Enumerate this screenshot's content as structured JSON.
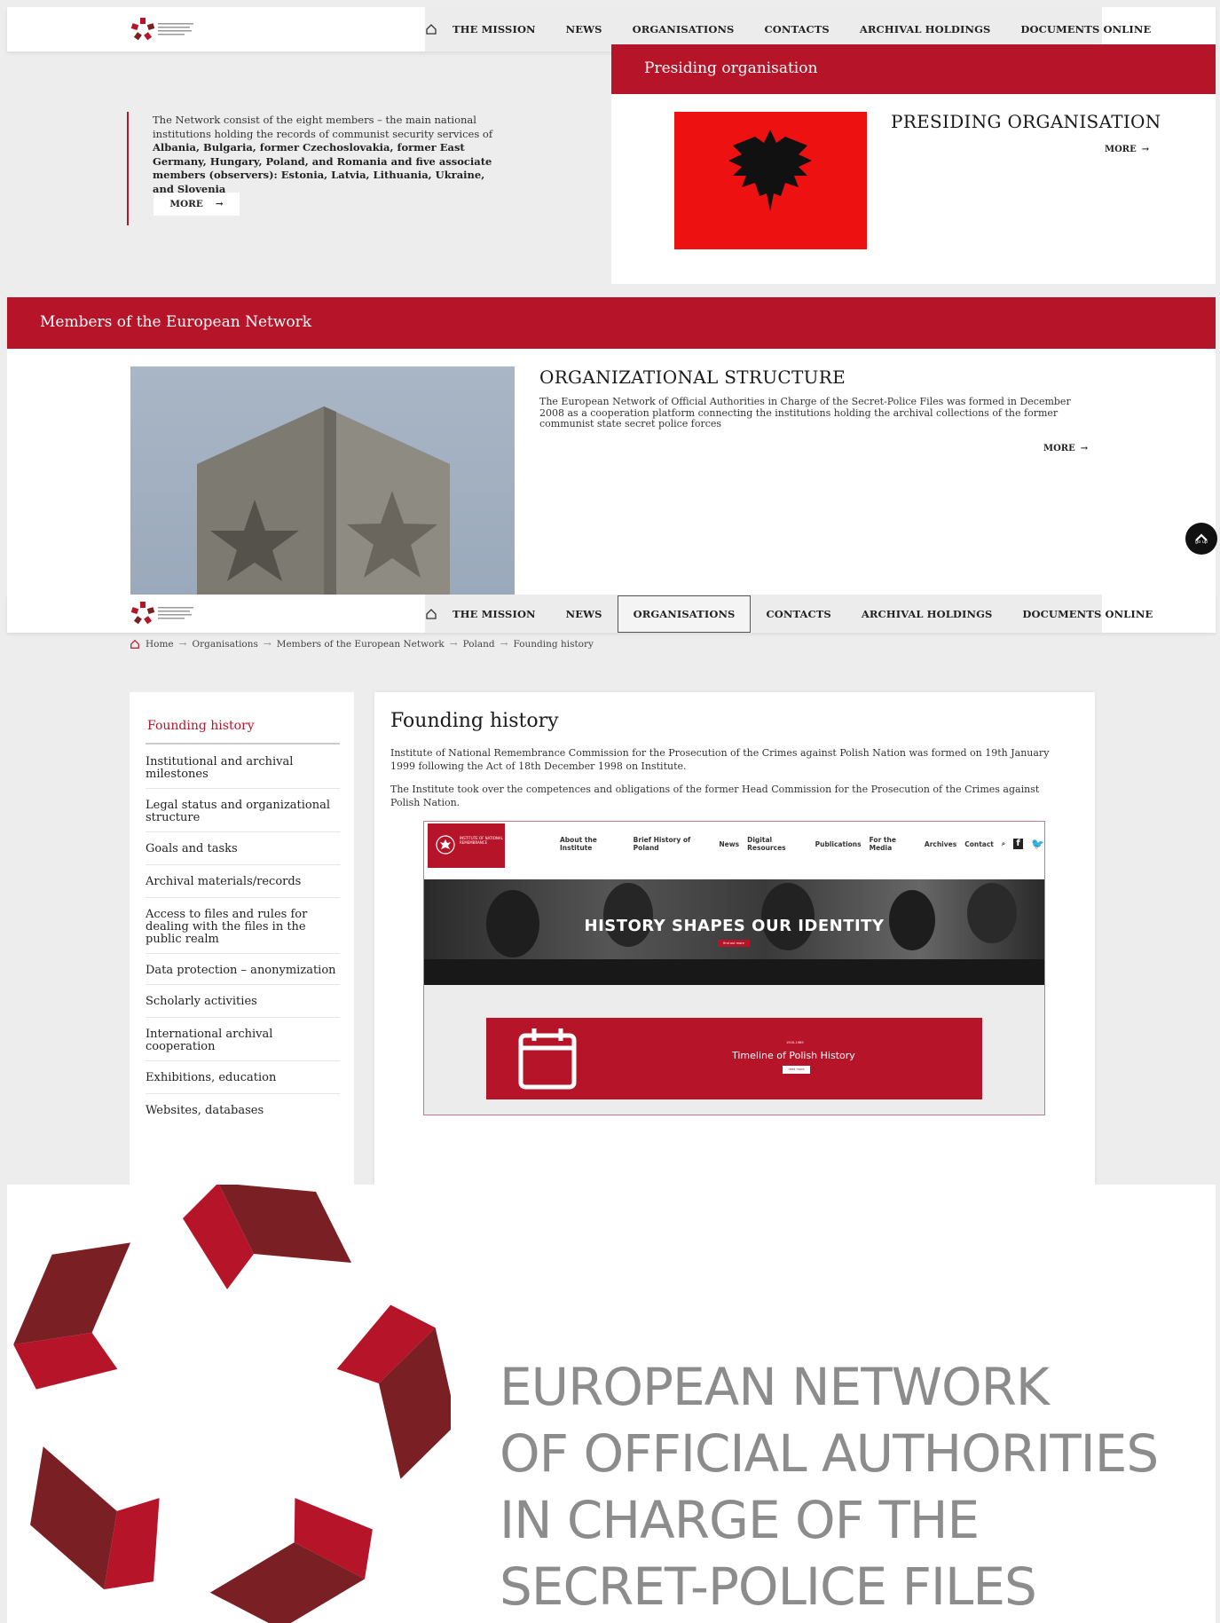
{
  "nav": {
    "items": [
      "THE MISSION",
      "NEWS",
      "ORGANISATIONS",
      "CONTACTS",
      "ARCHIVAL HOLDINGS",
      "DOCUMENTS ONLINE"
    ]
  },
  "home": {
    "intro_text": "The Network consist of the eight members – the main national institutions holding the records of communist security services of",
    "intro_bold": "Albania, Bulgaria, former Czechoslovakia, former East Germany, Hungary, Poland, and Romania and five associate members (observers): Estonia, Latvia, Lithuania, Ukraine, and Slovenia",
    "intro_more": "MORE",
    "presiding_header": "Presiding organisation",
    "presiding_title": "PRESIDING ORGANISATION",
    "presiding_more": "MORE",
    "members_header": "Members of the European Network",
    "structure_title": "ORGANIZATIONAL STRUCTURE",
    "structure_desc": "The European Network of Official Authorities in Charge of the Secret-Police Files was formed in December 2008 as a cooperation platform connecting the institutions holding the archival collections of the former communist state secret police forces",
    "structure_more": "MORE",
    "go_up": "go up"
  },
  "breadcrumb": [
    "Home",
    "Organisations",
    "Members of the European Network",
    "Poland",
    "Founding history"
  ],
  "sidebar": {
    "active": "Founding history",
    "items": [
      "Institutional and archival milestones",
      "Legal status and organizational structure",
      "Goals and tasks",
      "Archival materials/records",
      "Access to files and rules for dealing with the files in the public realm",
      "Data protection – anonymization",
      "Scholarly activities",
      "International archival cooperation",
      "Exhibitions, education",
      "Websites, databases"
    ]
  },
  "article": {
    "title": "Founding history",
    "p1": "Institute of National Remembrance  Commission for the Prosecution of the Crimes against Polish Nation was formed on 19th January 1999 following the Act of 18th December 1998 on Institute.",
    "p2": "The Institute took over the competences and obligations of the former Head Commission for the Prosecution of the Crimes against Polish Nation."
  },
  "ipn": {
    "logo_text": "INSTITUTE OF NATIONAL REMEMBRANCE",
    "menu": [
      "About the Institute",
      "Brief History of Poland",
      "News",
      "Digital Resources",
      "Publications",
      "For the Media",
      "Archives",
      "Contact"
    ],
    "banner_title": "HISTORY SHAPES OUR IDENTITY",
    "banner_btn": "find out more",
    "card_sub": "1918–1989",
    "card_title": "Timeline of Polish History",
    "card_btn": "read more"
  },
  "logo": {
    "line1": "EUROPEAN NETWORK",
    "line2": "OF OFFICIAL AUTHORITIES",
    "line3": "IN CHARGE OF THE",
    "line4": "SECRET-POLICE FILES",
    "colors": {
      "red": "#b51429",
      "dark": "#7a2024",
      "grey": "#8c8c8c"
    }
  }
}
